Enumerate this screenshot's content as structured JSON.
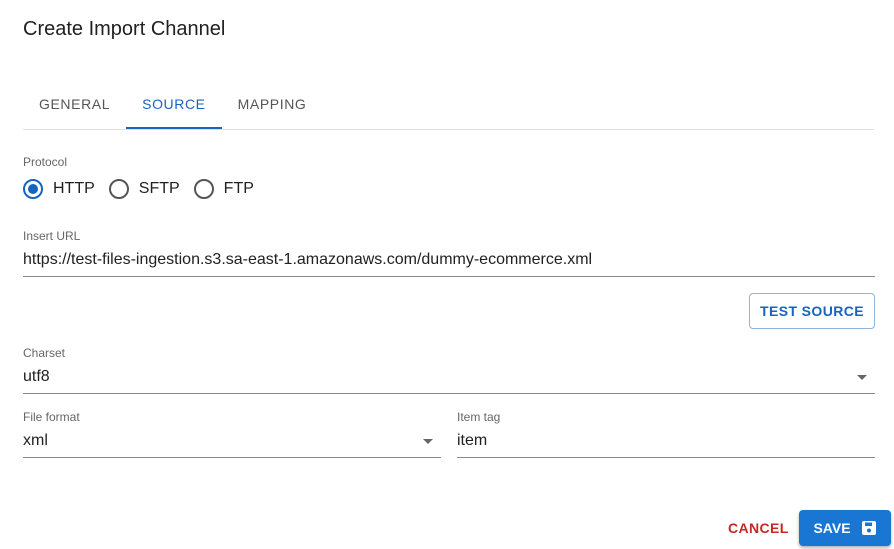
{
  "dialog": {
    "title": "Create Import Channel"
  },
  "tabs": [
    {
      "label": "GENERAL"
    },
    {
      "label": "SOURCE"
    },
    {
      "label": "MAPPING"
    }
  ],
  "protocol": {
    "label": "Protocol",
    "options": [
      "HTTP",
      "SFTP",
      "FTP"
    ],
    "selected": "HTTP"
  },
  "url": {
    "label": "Insert URL",
    "value": "https://test-files-ingestion.s3.sa-east-1.amazonaws.com/dummy-ecommerce.xml"
  },
  "test_source": "TEST SOURCE",
  "charset": {
    "label": "Charset",
    "value": "utf8"
  },
  "file_format": {
    "label": "File format",
    "value": "xml"
  },
  "item_tag": {
    "label": "Item tag",
    "value": "item"
  },
  "actions": {
    "cancel": "CANCEL",
    "save": "SAVE"
  },
  "colors": {
    "primary": "#1976d2",
    "danger": "#c62828"
  }
}
